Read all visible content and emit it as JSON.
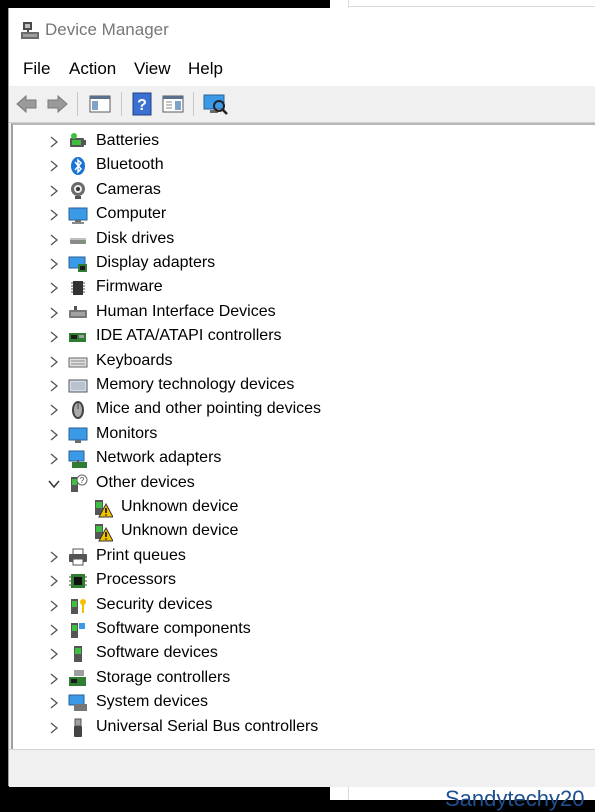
{
  "window": {
    "title": "Device Manager"
  },
  "menu": [
    "File",
    "Action",
    "View",
    "Help"
  ],
  "toolbar": [
    {
      "name": "back-arrow-icon"
    },
    {
      "name": "forward-arrow-icon"
    },
    {
      "name": "show-hide-console-tree-icon"
    },
    {
      "name": "help-icon"
    },
    {
      "name": "properties-pane-icon"
    },
    {
      "name": "scan-hardware-changes-icon"
    }
  ],
  "tree": [
    {
      "label": "Batteries",
      "icon": "battery-icon",
      "level": 0,
      "state": "collapsed"
    },
    {
      "label": "Bluetooth",
      "icon": "bluetooth-icon",
      "level": 0,
      "state": "collapsed"
    },
    {
      "label": "Cameras",
      "icon": "camera-icon",
      "level": 0,
      "state": "collapsed"
    },
    {
      "label": "Computer",
      "icon": "computer-icon",
      "level": 0,
      "state": "collapsed"
    },
    {
      "label": "Disk drives",
      "icon": "disk-drive-icon",
      "level": 0,
      "state": "collapsed"
    },
    {
      "label": "Display adapters",
      "icon": "display-adapter-icon",
      "level": 0,
      "state": "collapsed"
    },
    {
      "label": "Firmware",
      "icon": "firmware-chip-icon",
      "level": 0,
      "state": "collapsed"
    },
    {
      "label": "Human Interface Devices",
      "icon": "hid-icon",
      "level": 0,
      "state": "collapsed"
    },
    {
      "label": "IDE ATA/ATAPI controllers",
      "icon": "ide-controller-icon",
      "level": 0,
      "state": "collapsed"
    },
    {
      "label": "Keyboards",
      "icon": "keyboard-icon",
      "level": 0,
      "state": "collapsed"
    },
    {
      "label": "Memory technology devices",
      "icon": "memory-device-icon",
      "level": 0,
      "state": "collapsed"
    },
    {
      "label": "Mice and other pointing devices",
      "icon": "mouse-icon",
      "level": 0,
      "state": "collapsed"
    },
    {
      "label": "Monitors",
      "icon": "monitor-icon",
      "level": 0,
      "state": "collapsed"
    },
    {
      "label": "Network adapters",
      "icon": "network-adapter-icon",
      "level": 0,
      "state": "collapsed"
    },
    {
      "label": "Other devices",
      "icon": "other-devices-icon",
      "level": 0,
      "state": "expanded"
    },
    {
      "label": "Unknown device",
      "icon": "unknown-device-warning-icon",
      "level": 1,
      "state": "leaf"
    },
    {
      "label": "Unknown device",
      "icon": "unknown-device-warning-icon",
      "level": 1,
      "state": "leaf"
    },
    {
      "label": "Print queues",
      "icon": "printer-icon",
      "level": 0,
      "state": "collapsed"
    },
    {
      "label": "Processors",
      "icon": "processor-icon",
      "level": 0,
      "state": "collapsed"
    },
    {
      "label": "Security devices",
      "icon": "security-device-icon",
      "level": 0,
      "state": "collapsed"
    },
    {
      "label": "Software components",
      "icon": "software-component-icon",
      "level": 0,
      "state": "collapsed"
    },
    {
      "label": "Software devices",
      "icon": "software-device-icon",
      "level": 0,
      "state": "collapsed"
    },
    {
      "label": "Storage controllers",
      "icon": "storage-controller-icon",
      "level": 0,
      "state": "collapsed"
    },
    {
      "label": "System devices",
      "icon": "system-devices-icon",
      "level": 0,
      "state": "collapsed"
    },
    {
      "label": "Universal Serial Bus controllers",
      "icon": "usb-icon",
      "level": 0,
      "state": "collapsed"
    }
  ],
  "background": {
    "watermark": "Sandytechy20"
  },
  "colors": {
    "accent": "#1a74d4",
    "warning": "#f2c200",
    "monitor": "#3a9ae8"
  }
}
